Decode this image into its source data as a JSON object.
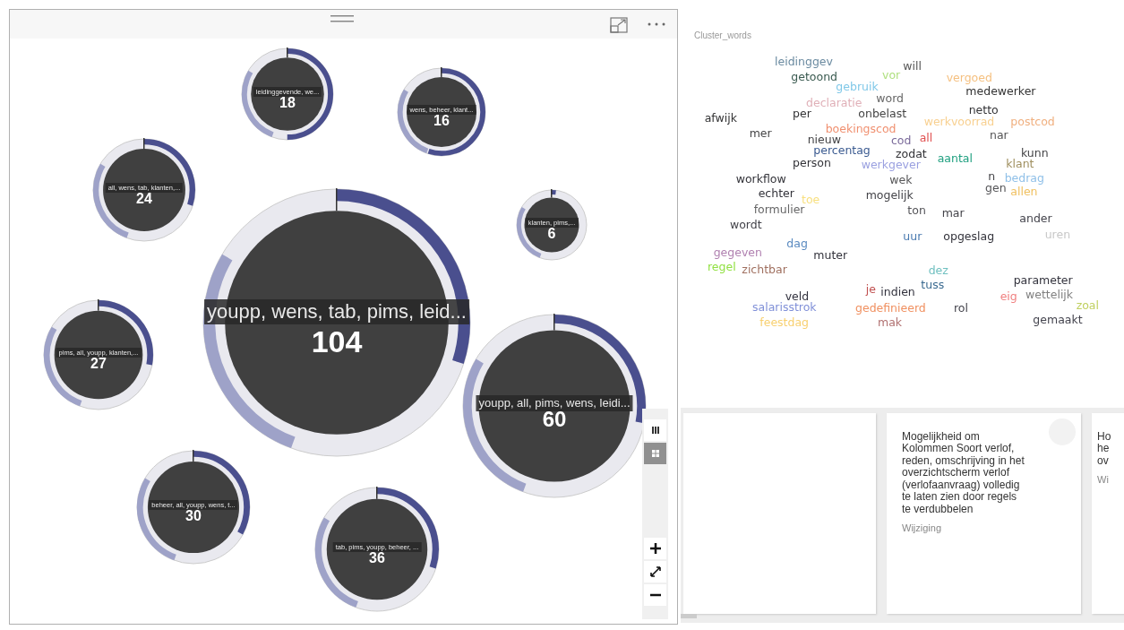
{
  "bubble_chart": {
    "view_toggles": [
      {
        "selected": false
      },
      {
        "selected": true
      }
    ],
    "bubbles": [
      {
        "label": "leidinggevende, we...",
        "count": "18"
      },
      {
        "label": "wens, beheer, klant...",
        "count": "16"
      },
      {
        "label": "all, wens, tab, klanten,...",
        "count": "24"
      },
      {
        "label": "klanten, pims,...",
        "count": "6"
      },
      {
        "label": "youpp, wens, tab, pims, leid...",
        "count": "104"
      },
      {
        "label": "pims, all, youpp, klanten,...",
        "count": "27"
      },
      {
        "label": "youpp, all, pims, wens, leidi...",
        "count": "60"
      },
      {
        "label": "beheer, all, youpp, wens, t...",
        "count": "30"
      },
      {
        "label": "tab, pims, youpp, beheer, ...",
        "count": "36"
      }
    ]
  },
  "word_cloud": {
    "title": "Cluster_words",
    "words": [
      {
        "text": "leidinggev",
        "color": "#6a8aa0"
      },
      {
        "text": "will",
        "color": "#555555"
      },
      {
        "text": "getoond",
        "color": "#3a5a50"
      },
      {
        "text": "vor",
        "color": "#b0e080"
      },
      {
        "text": "vergoed",
        "color": "#f5c080"
      },
      {
        "text": "gebruik",
        "color": "#80c8e8"
      },
      {
        "text": "medewerker",
        "color": "#333333"
      },
      {
        "text": "declaratie",
        "color": "#e0b0b8"
      },
      {
        "text": "word",
        "color": "#666666"
      },
      {
        "text": "afwijk",
        "color": "#333334"
      },
      {
        "text": "per",
        "color": "#333335"
      },
      {
        "text": "onbelast",
        "color": "#444444"
      },
      {
        "text": "netto",
        "color": "#333336"
      },
      {
        "text": "werkvoorrad",
        "color": "#f8d090"
      },
      {
        "text": "postcod",
        "color": "#f0b080"
      },
      {
        "text": "mer",
        "color": "#444445"
      },
      {
        "text": "boekingscod",
        "color": "#f09070"
      },
      {
        "text": "nieuw",
        "color": "#444446"
      },
      {
        "text": "cod",
        "color": "#7a6a9a"
      },
      {
        "text": "all",
        "color": "#e05050"
      },
      {
        "text": "nar",
        "color": "#555556"
      },
      {
        "text": "percentag",
        "color": "#3a5a90"
      },
      {
        "text": "zodat",
        "color": "#333337"
      },
      {
        "text": "aantal",
        "color": "#20a080"
      },
      {
        "text": "kunn",
        "color": "#444447"
      },
      {
        "text": "person",
        "color": "#333338"
      },
      {
        "text": "werkgever",
        "color": "#9aa0e0"
      },
      {
        "text": "klant",
        "color": "#a09060"
      },
      {
        "text": "workflow",
        "color": "#333339"
      },
      {
        "text": "wek",
        "color": "#555557"
      },
      {
        "text": "n",
        "color": "#444448"
      },
      {
        "text": "bedrag",
        "color": "#90c0e8"
      },
      {
        "text": "echter",
        "color": "#33333a"
      },
      {
        "text": "toe",
        "color": "#f8e080"
      },
      {
        "text": "mogelijk",
        "color": "#444449"
      },
      {
        "text": "gen",
        "color": "#555558"
      },
      {
        "text": "allen",
        "color": "#f0c060"
      },
      {
        "text": "formulier",
        "color": "#666667"
      },
      {
        "text": "ton",
        "color": "#555559"
      },
      {
        "text": "mar",
        "color": "#44444a"
      },
      {
        "text": "wordt",
        "color": "#44444b"
      },
      {
        "text": "ander",
        "color": "#44444c"
      },
      {
        "text": "uur",
        "color": "#4a7ab0"
      },
      {
        "text": "opgeslag",
        "color": "#33333b"
      },
      {
        "text": "uren",
        "color": "#c8c8c8"
      },
      {
        "text": "dag",
        "color": "#5a8ac0"
      },
      {
        "text": "gegeven",
        "color": "#b080b0"
      },
      {
        "text": "muter",
        "color": "#33333c"
      },
      {
        "text": "regel",
        "color": "#90e040"
      },
      {
        "text": "zichtbar",
        "color": "#a07060"
      },
      {
        "text": "dez",
        "color": "#70c0c0"
      },
      {
        "text": "parameter",
        "color": "#33333d"
      },
      {
        "text": "tuss",
        "color": "#3a6a90"
      },
      {
        "text": "je",
        "color": "#c05050"
      },
      {
        "text": "indien",
        "color": "#33333e"
      },
      {
        "text": "veld",
        "color": "#33333f"
      },
      {
        "text": "eig",
        "color": "#f08080"
      },
      {
        "text": "wettelijk",
        "color": "#808080"
      },
      {
        "text": "salarisstrok",
        "color": "#8090d8"
      },
      {
        "text": "gedefinieerd",
        "color": "#f09060"
      },
      {
        "text": "rol",
        "color": "#44444d"
      },
      {
        "text": "zoal",
        "color": "#c0d060"
      },
      {
        "text": "feestdag",
        "color": "#f8d070"
      },
      {
        "text": "mak",
        "color": "#b07070"
      },
      {
        "text": "gemaakt",
        "color": "#44444e"
      }
    ]
  },
  "cards": [
    {
      "kind": "empty"
    },
    {
      "kind": "text",
      "text": "Mogelijkheid om Kolommen Soort verlof, reden, omschrijving in het overzichtscherm verlof (verlofaanvraag) volledig te laten zien door regels te verdubbelen",
      "tag": "Wijziging"
    },
    {
      "kind": "cut",
      "lines": [
        "Ho",
        "he",
        "ov"
      ],
      "tag": "Wi"
    }
  ]
}
